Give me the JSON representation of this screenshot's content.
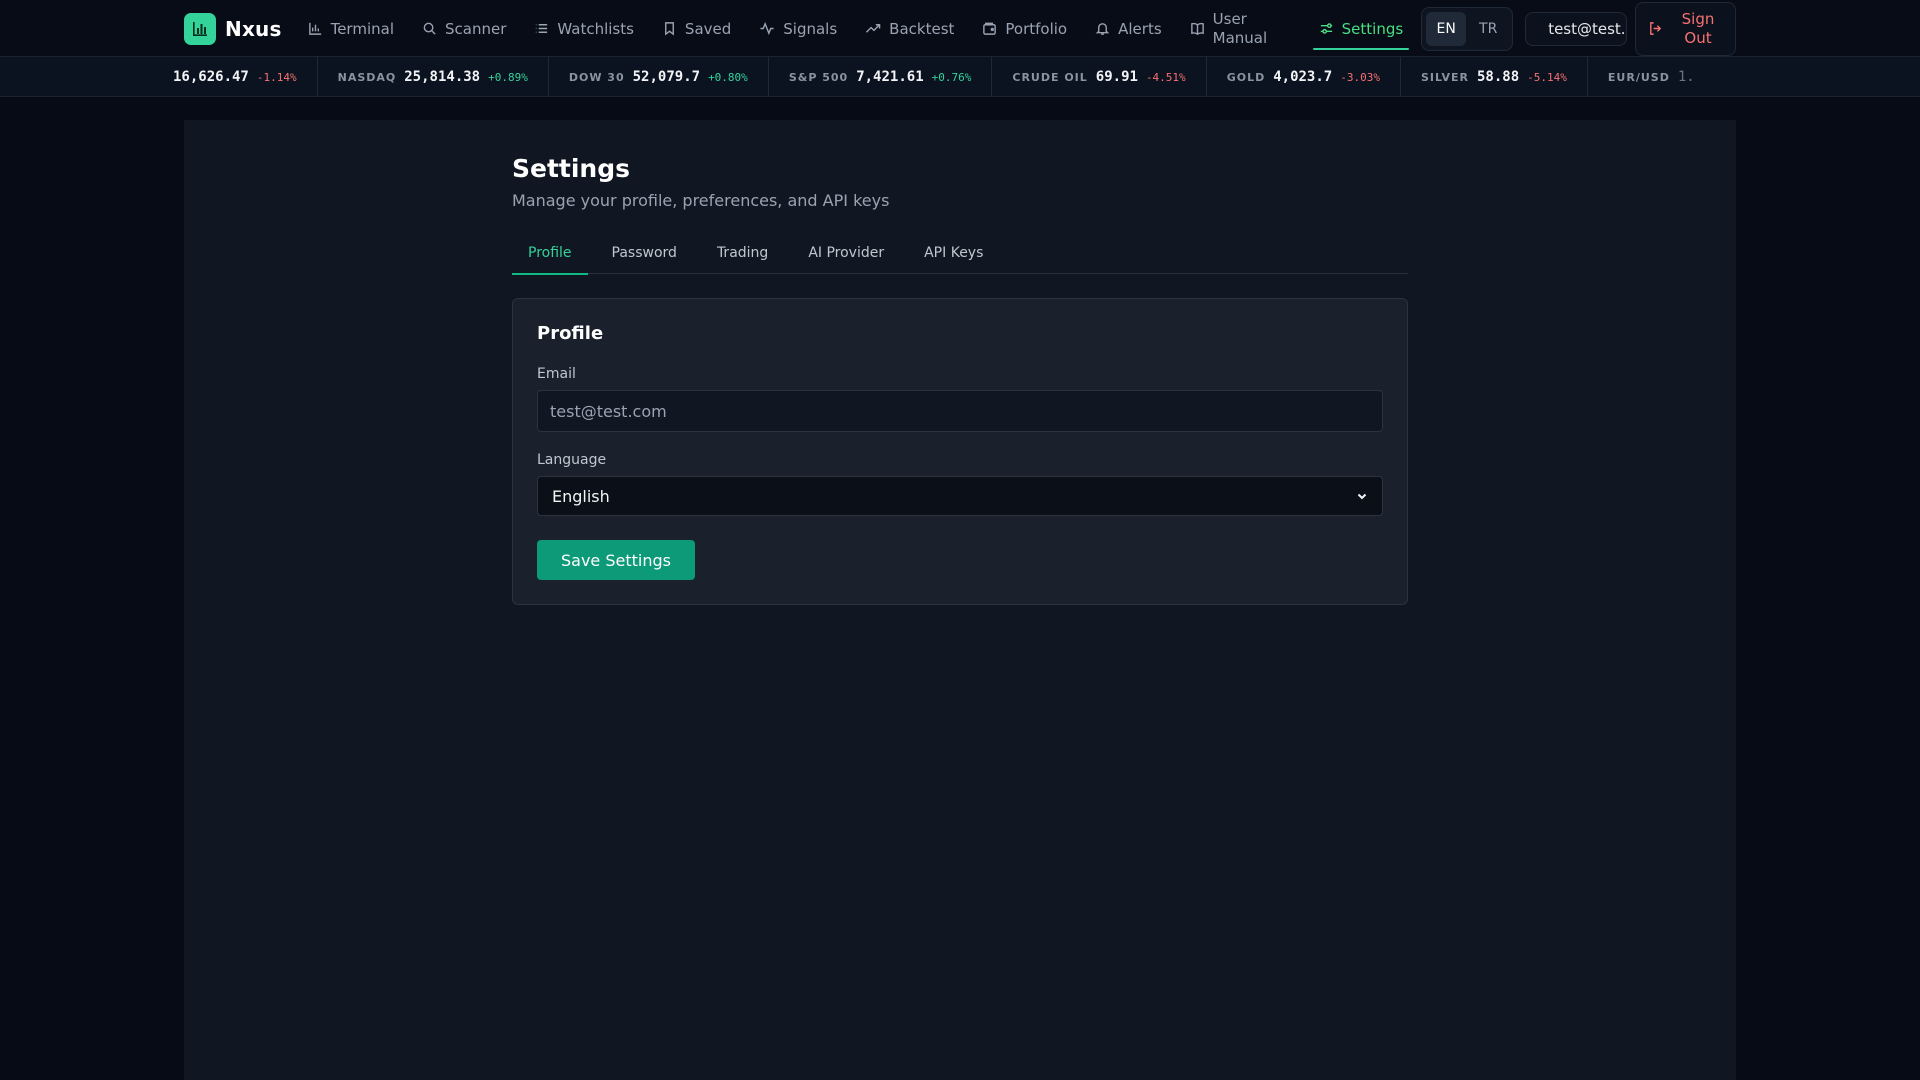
{
  "brand": {
    "name": "Nxus"
  },
  "nav": {
    "items": [
      {
        "label": "Terminal",
        "icon": "bar-chart-icon"
      },
      {
        "label": "Scanner",
        "icon": "search-icon"
      },
      {
        "label": "Watchlists",
        "icon": "list-icon"
      },
      {
        "label": "Saved",
        "icon": "bookmark-icon"
      },
      {
        "label": "Signals",
        "icon": "activity-icon"
      },
      {
        "label": "Backtest",
        "icon": "trending-up-icon"
      },
      {
        "label": "Portfolio",
        "icon": "wallet-icon"
      },
      {
        "label": "Alerts",
        "icon": "bell-icon"
      },
      {
        "label": "User Manual",
        "icon": "book-icon"
      }
    ],
    "settings_label": "Settings",
    "active": "Settings"
  },
  "language_switch": {
    "options": [
      "EN",
      "TR"
    ],
    "active": "EN"
  },
  "user": {
    "email_truncated": "test@test.c..."
  },
  "signout": {
    "label": "Sign Out"
  },
  "ticker": [
    {
      "name": "",
      "value": "16,626.47",
      "change": "-1.14%",
      "direction": "down"
    },
    {
      "name": "NASDAQ",
      "value": "25,814.38",
      "change": "+0.89%",
      "direction": "up"
    },
    {
      "name": "DOW 30",
      "value": "52,079.7",
      "change": "+0.80%",
      "direction": "up"
    },
    {
      "name": "S&P 500",
      "value": "7,421.61",
      "change": "+0.76%",
      "direction": "up"
    },
    {
      "name": "CRUDE OIL",
      "value": "69.91",
      "change": "-4.51%",
      "direction": "down"
    },
    {
      "name": "GOLD",
      "value": "4,023.7",
      "change": "-3.03%",
      "direction": "down"
    },
    {
      "name": "SILVER",
      "value": "58.88",
      "change": "-5.14%",
      "direction": "down"
    },
    {
      "name": "EUR/USD",
      "value": "1.",
      "change": "",
      "direction": "up"
    }
  ],
  "page": {
    "title": "Settings",
    "subtitle": "Manage your profile, preferences, and API keys"
  },
  "tabs": {
    "items": [
      "Profile",
      "Password",
      "Trading",
      "AI Provider",
      "API Keys"
    ],
    "active": "Profile"
  },
  "profile": {
    "title": "Profile",
    "email_label": "Email",
    "email_value": "test@test.com",
    "language_label": "Language",
    "language_value": "English",
    "save_label": "Save Settings"
  },
  "colors": {
    "accent": "#10b981",
    "accent_text": "#34d399",
    "positive": "#34d399",
    "negative": "#f87171",
    "background": "#060b16",
    "panel": "#111722",
    "card": "#1a202c"
  }
}
